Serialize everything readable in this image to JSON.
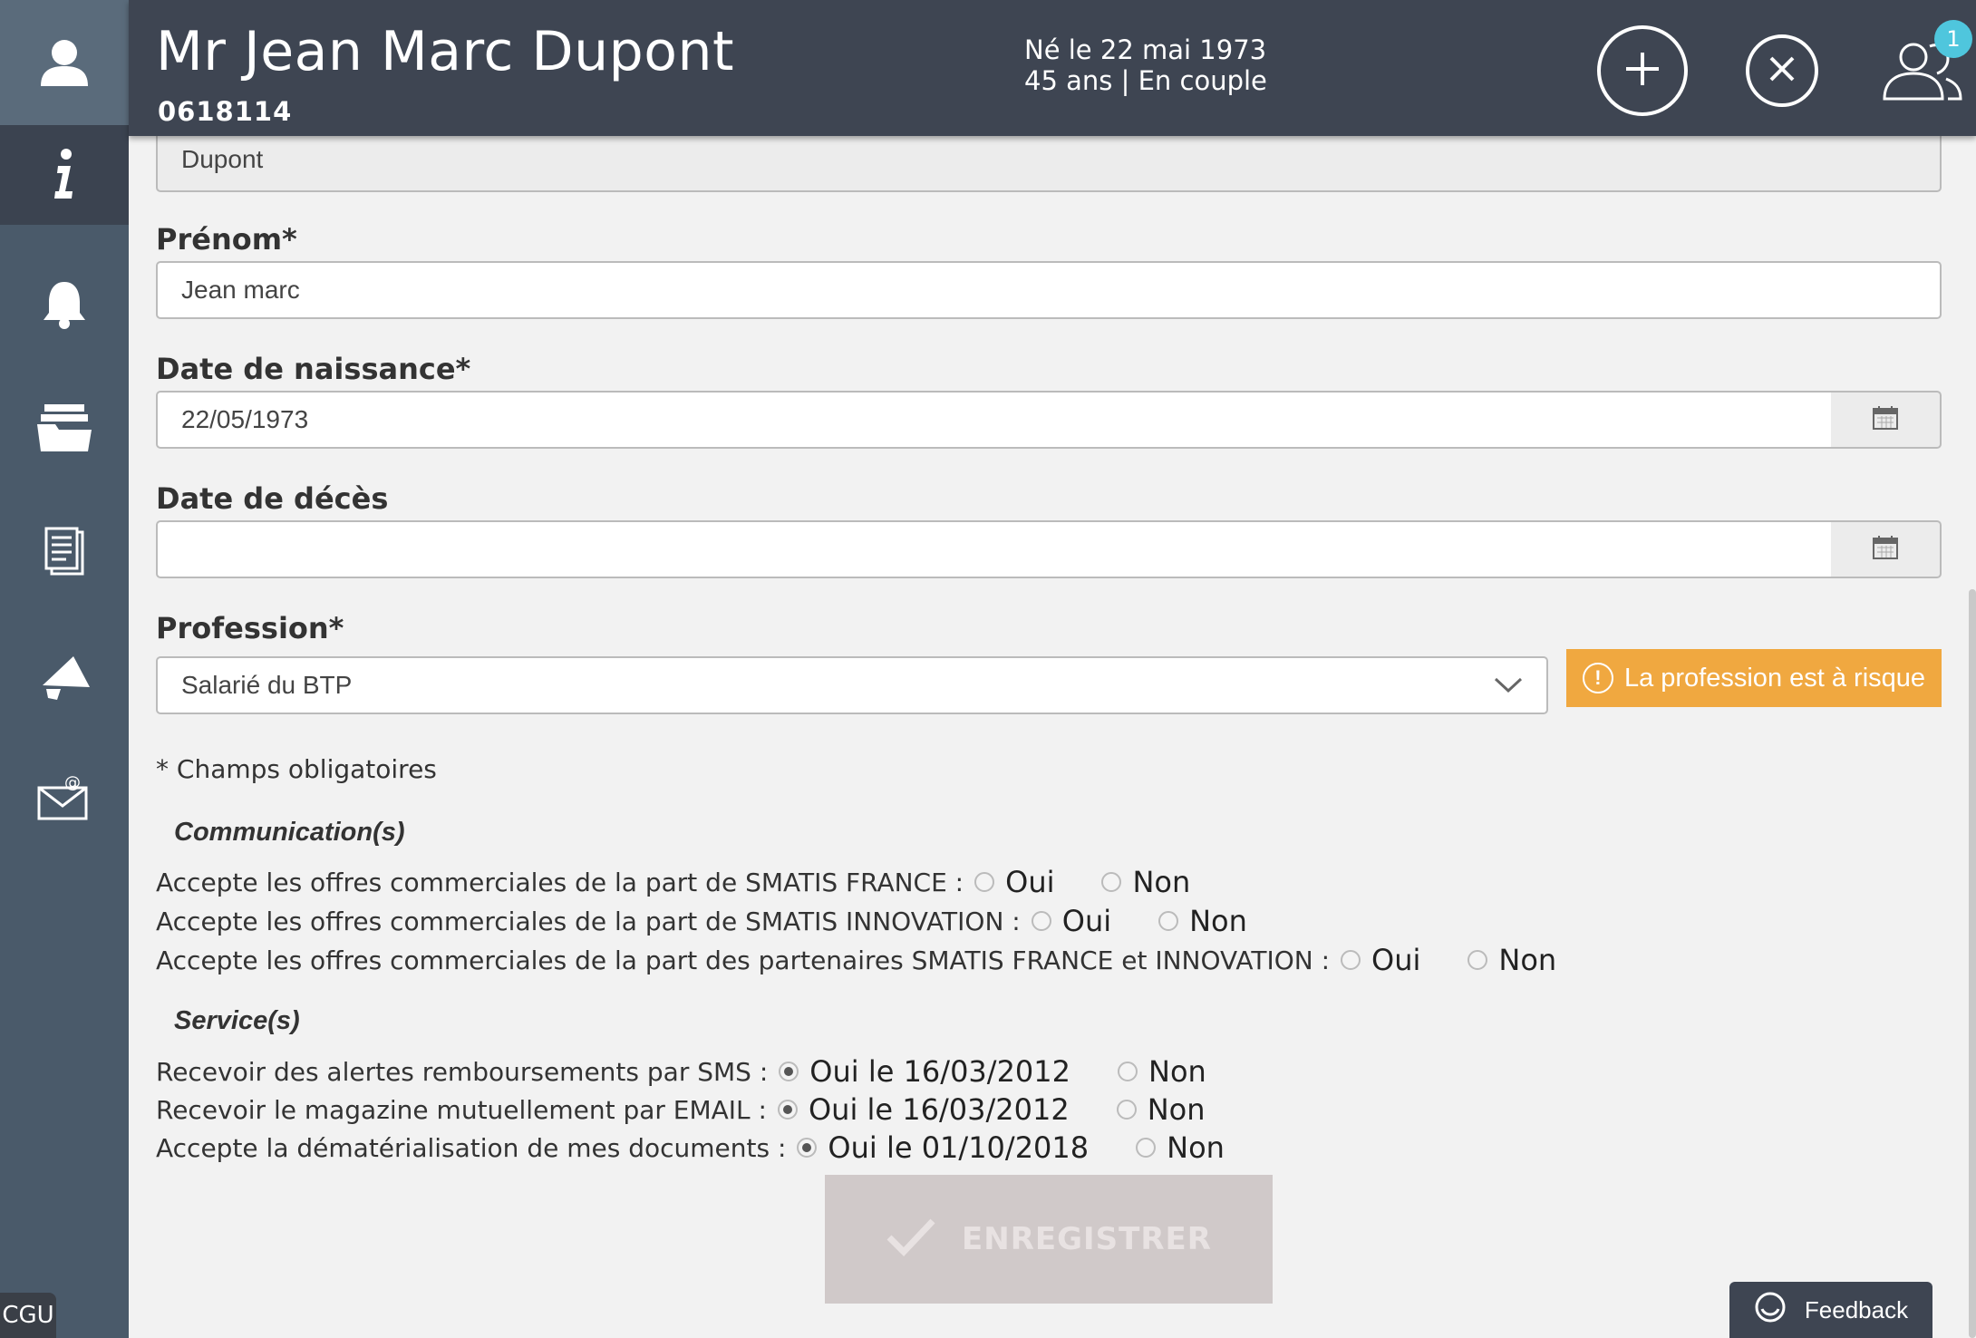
{
  "header": {
    "name": "Mr Jean Marc Dupont",
    "number": "0618114",
    "birth_line": "Né le 22 mai 1973",
    "status_line": "45 ans | En couple",
    "users_badge": "1"
  },
  "sidebar": {
    "items": [
      {
        "icon": "user-icon"
      },
      {
        "icon": "info-icon"
      },
      {
        "icon": "bell-icon"
      },
      {
        "icon": "folders-icon"
      },
      {
        "icon": "document-icon"
      },
      {
        "icon": "megaphone-icon"
      },
      {
        "icon": "email-icon"
      }
    ],
    "cgu": "CGU"
  },
  "form": {
    "nom_value": "Dupont",
    "prenom_label": "Prénom*",
    "prenom_value": "Jean marc",
    "naissance_label": "Date de naissance*",
    "naissance_value": "22/05/1973",
    "deces_label": "Date de décès",
    "deces_value": "",
    "profession_label": "Profession*",
    "profession_value": "Salarié du BTP",
    "profession_warning": "La profession est à risque",
    "required_note": "* Champs obligatoires"
  },
  "communications": {
    "title": "Communication(s)",
    "rows": [
      {
        "label": "Accepte les offres commerciales de la part de SMATIS FRANCE :",
        "yes": "Oui",
        "no": "Non",
        "selected": "none"
      },
      {
        "label": "Accepte les offres commerciales de la part de SMATIS INNOVATION :",
        "yes": "Oui",
        "no": "Non",
        "selected": "none"
      },
      {
        "label": "Accepte les offres commerciales de la part des partenaires SMATIS FRANCE et INNOVATION :",
        "yes": "Oui",
        "no": "Non",
        "selected": "none"
      }
    ]
  },
  "services": {
    "title": "Service(s)",
    "rows": [
      {
        "label": "Recevoir des alertes remboursements par SMS :",
        "yes": "Oui le 16/03/2012",
        "no": "Non",
        "selected": "yes"
      },
      {
        "label": "Recevoir le magazine mutuellement par EMAIL :",
        "yes": "Oui le 16/03/2012",
        "no": "Non",
        "selected": "yes"
      },
      {
        "label": "Accepte la dématérialisation de mes documents :",
        "yes": "Oui le 01/10/2018",
        "no": "Non",
        "selected": "yes"
      }
    ]
  },
  "actions": {
    "save_label": "ENREGISTRER",
    "feedback_label": "Feedback"
  },
  "colors": {
    "header_bg": "#3e4552",
    "sidebar_bg": "#4a5a6a",
    "warning": "#f0a840",
    "badge": "#4fc6dd"
  }
}
